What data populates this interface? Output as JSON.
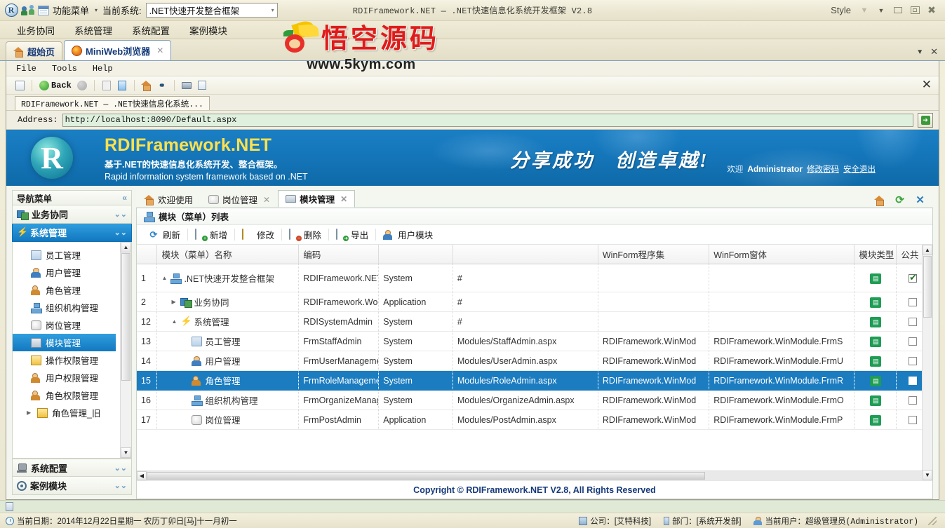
{
  "window": {
    "caption": "RDIFramework.NET — .NET快速信息化系统开发框架  V2.8",
    "style_label": "Style",
    "quick_access": {
      "func_menu_label": "功能菜单",
      "current_system_label": "当前系统:",
      "system_value": ".NET快速开发整合框架"
    },
    "ribbon_menus": [
      "业务协同",
      "系统管理",
      "系统配置",
      "案例模块"
    ],
    "doc_tabs": [
      {
        "label": "超始页",
        "icon": "home-icon",
        "active": false,
        "closable": false
      },
      {
        "label": "MiniWeb浏览器",
        "icon": "firefox-icon",
        "active": true,
        "closable": true
      }
    ]
  },
  "browser": {
    "menu": [
      "File",
      "Tools",
      "Help"
    ],
    "toolbar": {
      "back_label": "Back",
      "icons": [
        "new-page-icon",
        "back-icon",
        "forward-icon",
        "stop-icon",
        "refresh-icon",
        "home-icon",
        "search-icon",
        "print-icon",
        "print-preview-icon"
      ],
      "close_label": "✕"
    },
    "page_tab": "RDIFramework.NET — .NET快速信息化系统...",
    "address_label": "Address:",
    "address_value": "http://localhost:8090/Default.aspx",
    "go_label": "➜"
  },
  "banner": {
    "logo_letter": "R",
    "title": "RDIFramework.NET",
    "subtitle_cn": "基于.NET的快速信息化系统开发、整合框架。",
    "subtitle_en": "Rapid information system framework based on .NET",
    "slogan": "分享成功　创造卓越!",
    "welcome_prefix": "欢迎",
    "user": "Administrator",
    "links": [
      "修改密码",
      "安全退出"
    ]
  },
  "sidebar": {
    "title": "导航菜单",
    "collapse_icon": "«",
    "groups": [
      {
        "label": "业务协同",
        "icon": "business-icon",
        "active": false,
        "chevron": "⌄⌄"
      },
      {
        "label": "系统管理",
        "icon": "flash-icon",
        "active": true,
        "chevron": "⌄⌄"
      }
    ],
    "items": [
      {
        "label": "员工管理",
        "icon": "staff-card-icon",
        "selected": false
      },
      {
        "label": "用户管理",
        "icon": "user-icon",
        "selected": false
      },
      {
        "label": "角色管理",
        "icon": "role-icon",
        "selected": false
      },
      {
        "label": "组织机构管理",
        "icon": "organize-icon",
        "selected": false
      },
      {
        "label": "岗位管理",
        "icon": "post-icon",
        "selected": false
      },
      {
        "label": "模块管理",
        "icon": "module-icon",
        "selected": true
      },
      {
        "label": "操作权限管理",
        "icon": "permission-icon",
        "selected": false
      },
      {
        "label": "用户权限管理",
        "icon": "user-permission-icon",
        "selected": false
      },
      {
        "label": "角色权限管理",
        "icon": "role-permission-icon",
        "selected": false
      },
      {
        "label": "角色管理_旧",
        "icon": "role-old-icon",
        "selected": false
      }
    ],
    "bottom_groups": [
      {
        "label": "系统配置",
        "icon": "config-icon",
        "chevron": "⌄⌄"
      },
      {
        "label": "案例模块",
        "icon": "case-icon",
        "chevron": "⌄⌄"
      }
    ]
  },
  "content": {
    "tabs": [
      {
        "label": "欢迎使用",
        "icon": "home-icon",
        "active": false,
        "closable": false
      },
      {
        "label": "岗位管理",
        "icon": "post-icon",
        "active": false,
        "closable": true
      },
      {
        "label": "模块管理",
        "icon": "module-icon",
        "active": true,
        "closable": true
      }
    ],
    "tab_actions": [
      "home-icon",
      "refresh-icon",
      "close-icon"
    ],
    "panel_title": "模块（菜单）列表",
    "toolbar_buttons": [
      {
        "label": "刷新",
        "icon": "refresh-icon"
      },
      {
        "label": "新增",
        "icon": "add-icon"
      },
      {
        "label": "修改",
        "icon": "edit-icon"
      },
      {
        "label": "删除",
        "icon": "delete-icon"
      },
      {
        "label": "导出",
        "icon": "export-icon"
      },
      {
        "label": "用户模块",
        "icon": "user-module-icon"
      }
    ],
    "copyright": "Copyright © RDIFramework.NET V2.8, All Rights Reserved"
  },
  "grid": {
    "columns": [
      {
        "key": "no",
        "label": ""
      },
      {
        "key": "name",
        "label": "模块（菜单）名称"
      },
      {
        "key": "code",
        "label": "编码"
      },
      {
        "key": "type",
        "label": ""
      },
      {
        "key": "url",
        "label": ""
      },
      {
        "key": "assembly",
        "label": "WinForm程序集"
      },
      {
        "key": "form",
        "label": "WinForm窗体"
      },
      {
        "key": "modtype",
        "label": "模块类型"
      },
      {
        "key": "public",
        "label": "公共"
      }
    ],
    "rows": [
      {
        "no": "1",
        "name": ".NET快速开发整合框架",
        "code": "RDIFramework.NET",
        "type": "System",
        "url": "#",
        "assembly": "",
        "form": "",
        "modtype_icon": "module-type-icon",
        "public": true,
        "indent": 0,
        "expander": "▲",
        "icon": "tree-root-icon",
        "selected": false,
        "tall": true
      },
      {
        "no": "2",
        "name": "业务协同",
        "code": "RDIFramework.Work",
        "type": "Application",
        "url": "#",
        "assembly": "",
        "form": "",
        "modtype_icon": "module-type-icon",
        "public": false,
        "indent": 1,
        "expander": "▶",
        "icon": "business-icon",
        "selected": false,
        "tall": false
      },
      {
        "no": "12",
        "name": "系统管理",
        "code": "RDISystemAdmin",
        "type": "System",
        "url": "#",
        "assembly": "",
        "form": "",
        "modtype_icon": "module-type-icon",
        "public": false,
        "indent": 1,
        "expander": "▲",
        "icon": "flash-icon",
        "selected": false,
        "tall": false
      },
      {
        "no": "13",
        "name": "员工管理",
        "code": "FrmStaffAdmin",
        "type": "System",
        "url": "Modules/StaffAdmin.aspx",
        "assembly": "RDIFramework.WinMod",
        "form": "RDIFramework.WinModule.FrmS",
        "modtype_icon": "module-type-icon",
        "public": false,
        "indent": 2,
        "expander": "",
        "icon": "staff-card-icon",
        "selected": false,
        "tall": false
      },
      {
        "no": "14",
        "name": "用户管理",
        "code": "FrmUserManagemen",
        "type": "System",
        "url": "Modules/UserAdmin.aspx",
        "assembly": "RDIFramework.WinMod",
        "form": "RDIFramework.WinModule.FrmU",
        "modtype_icon": "module-type-icon",
        "public": false,
        "indent": 2,
        "expander": "",
        "icon": "user-icon",
        "selected": false,
        "tall": false
      },
      {
        "no": "15",
        "name": "角色管理",
        "code": "FrmRoleManagemen",
        "type": "System",
        "url": "Modules/RoleAdmin.aspx",
        "assembly": "RDIFramework.WinMod",
        "form": "RDIFramework.WinModule.FrmR",
        "modtype_icon": "module-type-icon",
        "public": false,
        "indent": 2,
        "expander": "",
        "icon": "role-icon",
        "selected": true,
        "tall": false
      },
      {
        "no": "16",
        "name": "组织机构管理",
        "code": "FrmOrganizeManage",
        "type": "System",
        "url": "Modules/OrganizeAdmin.aspx",
        "assembly": "RDIFramework.WinMod",
        "form": "RDIFramework.WinModule.FrmO",
        "modtype_icon": "module-type-icon",
        "public": false,
        "indent": 2,
        "expander": "",
        "icon": "organize-icon",
        "selected": false,
        "tall": false
      },
      {
        "no": "17",
        "name": "岗位管理",
        "code": "FrmPostAdmin",
        "type": "Application",
        "url": "Modules/PostAdmin.aspx",
        "assembly": "RDIFramework.WinMod",
        "form": "RDIFramework.WinModule.FrmP",
        "modtype_icon": "module-type-icon",
        "public": false,
        "indent": 2,
        "expander": "",
        "icon": "post-icon",
        "selected": false,
        "tall": false
      }
    ]
  },
  "watermark": {
    "text": "悟空源码",
    "url": "www.5kym.com"
  },
  "statusbar": {
    "date_text": "当前日期：2014年12月22日星期一  农历丁卯日[马]十一月初一",
    "company": "公司：[艾特科技]",
    "department": "部门：[系统开发部]",
    "current_user": "当前用户：超级管理员(Administrator)"
  },
  "colors": {
    "accent": "#1b7cc0",
    "banner_blue": "#1577bb",
    "banner_yellow": "#ffe14d",
    "chrome_beige": "#eae6d1",
    "watermark_red": "#e01b1b",
    "copyright_navy": "#16397a",
    "module_green": "#1f9d55"
  }
}
